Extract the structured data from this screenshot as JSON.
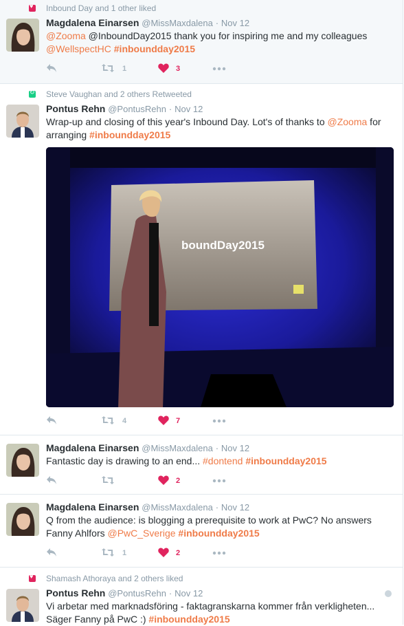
{
  "tweets": [
    {
      "context": "Inbound Day and 1 other liked",
      "name": "Magdalena Einarsen",
      "handle": "@MissMaxdalena",
      "sep": "·",
      "time": "Nov 12",
      "text": [
        "@Zooma",
        " @InboundDay2015 thank you for inspiring me and my colleagues",
        "@WellspectHC",
        " ",
        "#inboundday2015"
      ],
      "retweets": "1",
      "likes": "3"
    },
    {
      "context": "Steve Vaughan and 2 others Retweeted",
      "name": "Pontus Rehn",
      "handle": "@PontusRehn",
      "sep": "·",
      "time": "Nov 12",
      "text": [
        "Wrap-up and closing of this year's Inbound Day. Lot's of thanks to ",
        "@Zooma",
        " for",
        "arranging ",
        "#inboundday2015"
      ],
      "photo_caption": "boundDay2015",
      "retweets": "4",
      "likes": "7"
    },
    {
      "name": "Magdalena Einarsen",
      "handle": "@MissMaxdalena",
      "sep": "·",
      "time": "Nov 12",
      "text": [
        "Fantastic day is drawing to an end... ",
        "#dontend",
        " ",
        "#inboundday2015"
      ],
      "likes": "2"
    },
    {
      "name": "Magdalena Einarsen",
      "handle": "@MissMaxdalena",
      "sep": "·",
      "time": "Nov 12",
      "text": [
        "Q from the audience: is blogging a prerequisite to work at PwC? No answers",
        "Fanny Ahlfors ",
        "@PwC_Sverige",
        " ",
        "#inboundday2015"
      ],
      "retweets": "1",
      "likes": "2"
    },
    {
      "context": "Shamash Athoraya and 2 others liked",
      "name": "Pontus Rehn",
      "handle": "@PontusRehn",
      "sep": "·",
      "time": "Nov 12",
      "text": [
        "Vi arbetar med marknadsföring - faktagranskarna kommer från verkligheten...",
        "Säger Fanny på PwC :) ",
        "#inboundday2015"
      ]
    }
  ],
  "colors": {
    "accent": "#ef7b48",
    "like": "#e0245e",
    "retweet": "#19cf86",
    "muted": "#8899a6"
  },
  "icons": [
    "heart-icon",
    "retweet-icon",
    "reply-icon",
    "more-icon",
    "globe-icon"
  ]
}
